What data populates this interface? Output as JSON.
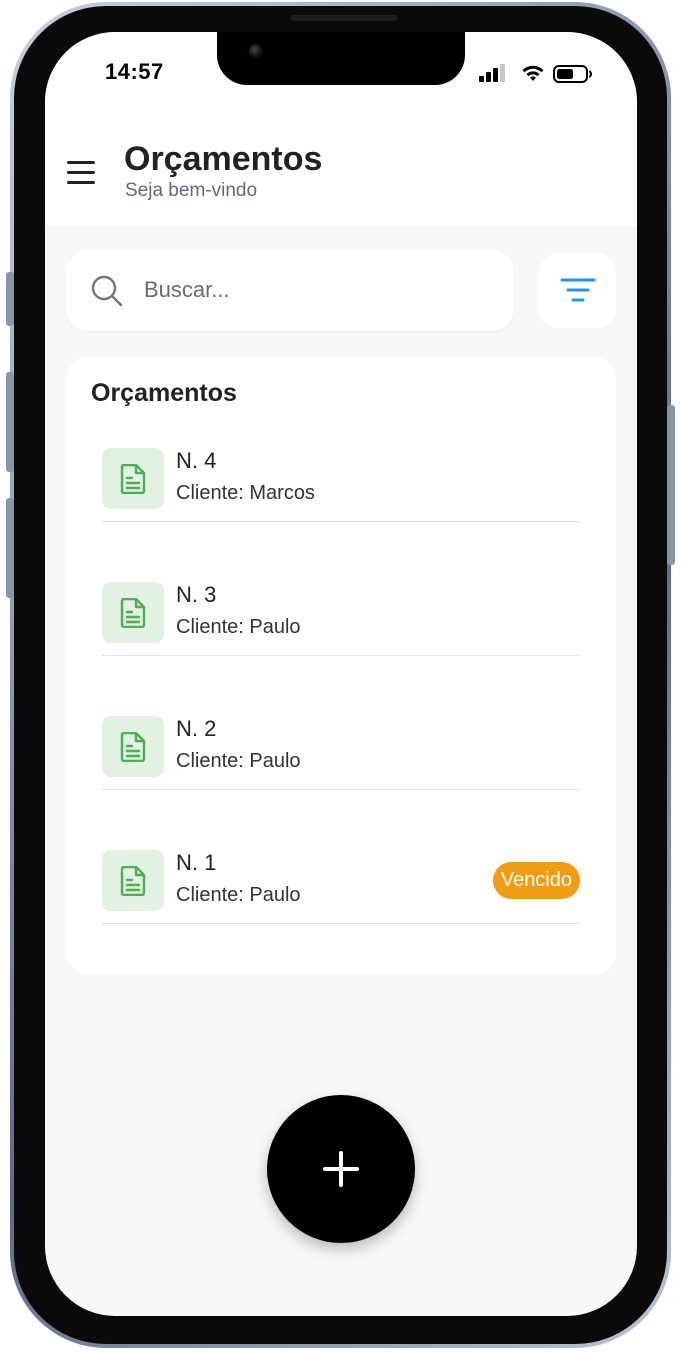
{
  "status_bar": {
    "time": "14:57"
  },
  "header": {
    "title": "Orçamentos",
    "subtitle": "Seja bem-vindo",
    "menu_icon": "hamburger-menu-icon"
  },
  "search": {
    "placeholder": "Buscar...",
    "value": "",
    "icon": "search-icon"
  },
  "filter": {
    "icon": "filter-icon",
    "color": "#2196f3"
  },
  "list": {
    "title": "Orçamentos",
    "items": [
      {
        "number": "N. 4",
        "client": "Cliente: Marcos",
        "badge": ""
      },
      {
        "number": "N. 3",
        "client": "Cliente: Paulo",
        "badge": ""
      },
      {
        "number": "N. 2",
        "client": "Cliente: Paulo",
        "badge": ""
      },
      {
        "number": "N. 1",
        "client": "Cliente: Paulo",
        "badge": "Vencido"
      }
    ]
  },
  "colors": {
    "accent": "#2196f3",
    "doc_icon_green": "#4caf50",
    "doc_icon_bg": "#e3f1e3",
    "badge_overdue": "#f39c12",
    "fab": "#000000"
  },
  "fab": {
    "icon": "plus-icon"
  }
}
